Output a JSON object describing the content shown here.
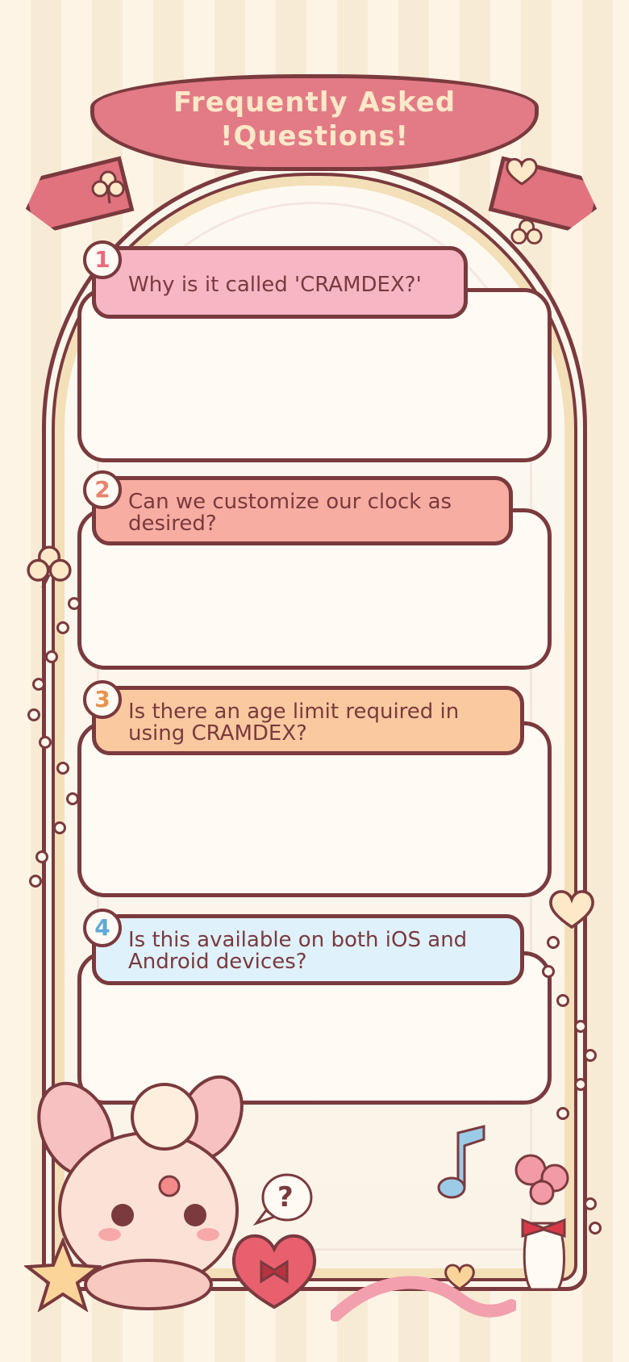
{
  "banner": {
    "line1": "Frequently Asked",
    "line2": "!Questions!"
  },
  "faqs": [
    {
      "number": "1",
      "question": "Why is it called 'CRAMDEX?'",
      "color": "#f6b6c4",
      "numColor": "#e86c7e"
    },
    {
      "number": "2",
      "question": "Can we customize our clock as desired?",
      "color": "#f7ada2",
      "numColor": "#e8826e"
    },
    {
      "number": "3",
      "question": "Is there an age limit required in using CRAMDEX?",
      "color": "#fbc9a0",
      "numColor": "#e8924e"
    },
    {
      "number": "4",
      "question": "Is this available on both iOS and Android devices?",
      "color": "#dff1fb",
      "numColor": "#5ea9d6"
    }
  ],
  "decorations": {
    "bubble_symbol": "?",
    "icons": [
      "clover-icon",
      "heart-icon",
      "music-note-icon",
      "star-icon",
      "bunny-mascot",
      "heart-box-icon",
      "flower-vase-icon",
      "ribbon-icon"
    ]
  }
}
